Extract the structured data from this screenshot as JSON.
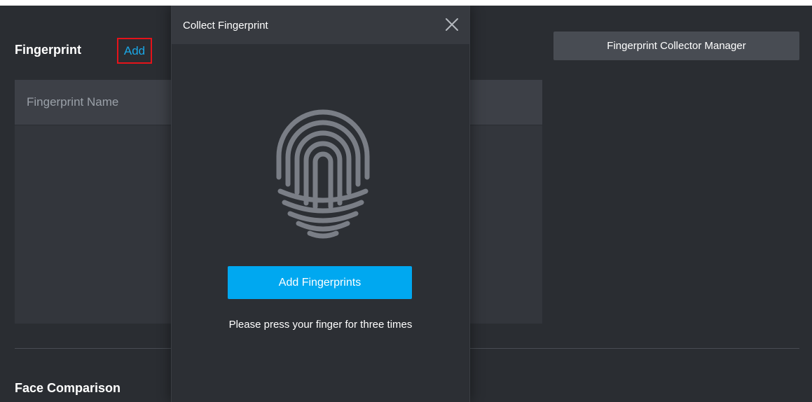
{
  "fingerprint_section": {
    "title": "Fingerprint",
    "add_link": "Add",
    "collector_button": "Fingerprint Collector Manager",
    "table": {
      "columns": [
        "Fingerprint Name"
      ]
    }
  },
  "face_section": {
    "title": "Face Comparison"
  },
  "modal": {
    "title": "Collect Fingerprint",
    "close_icon": "close-icon",
    "fingerprint_icon": "fingerprint-icon",
    "add_button": "Add Fingerprints",
    "hint": "Please press your finger for three times"
  },
  "colors": {
    "background": "#2a2d32",
    "accent": "#00a8f0",
    "link": "#1aa7e6",
    "highlight_box": "#e5131a"
  }
}
